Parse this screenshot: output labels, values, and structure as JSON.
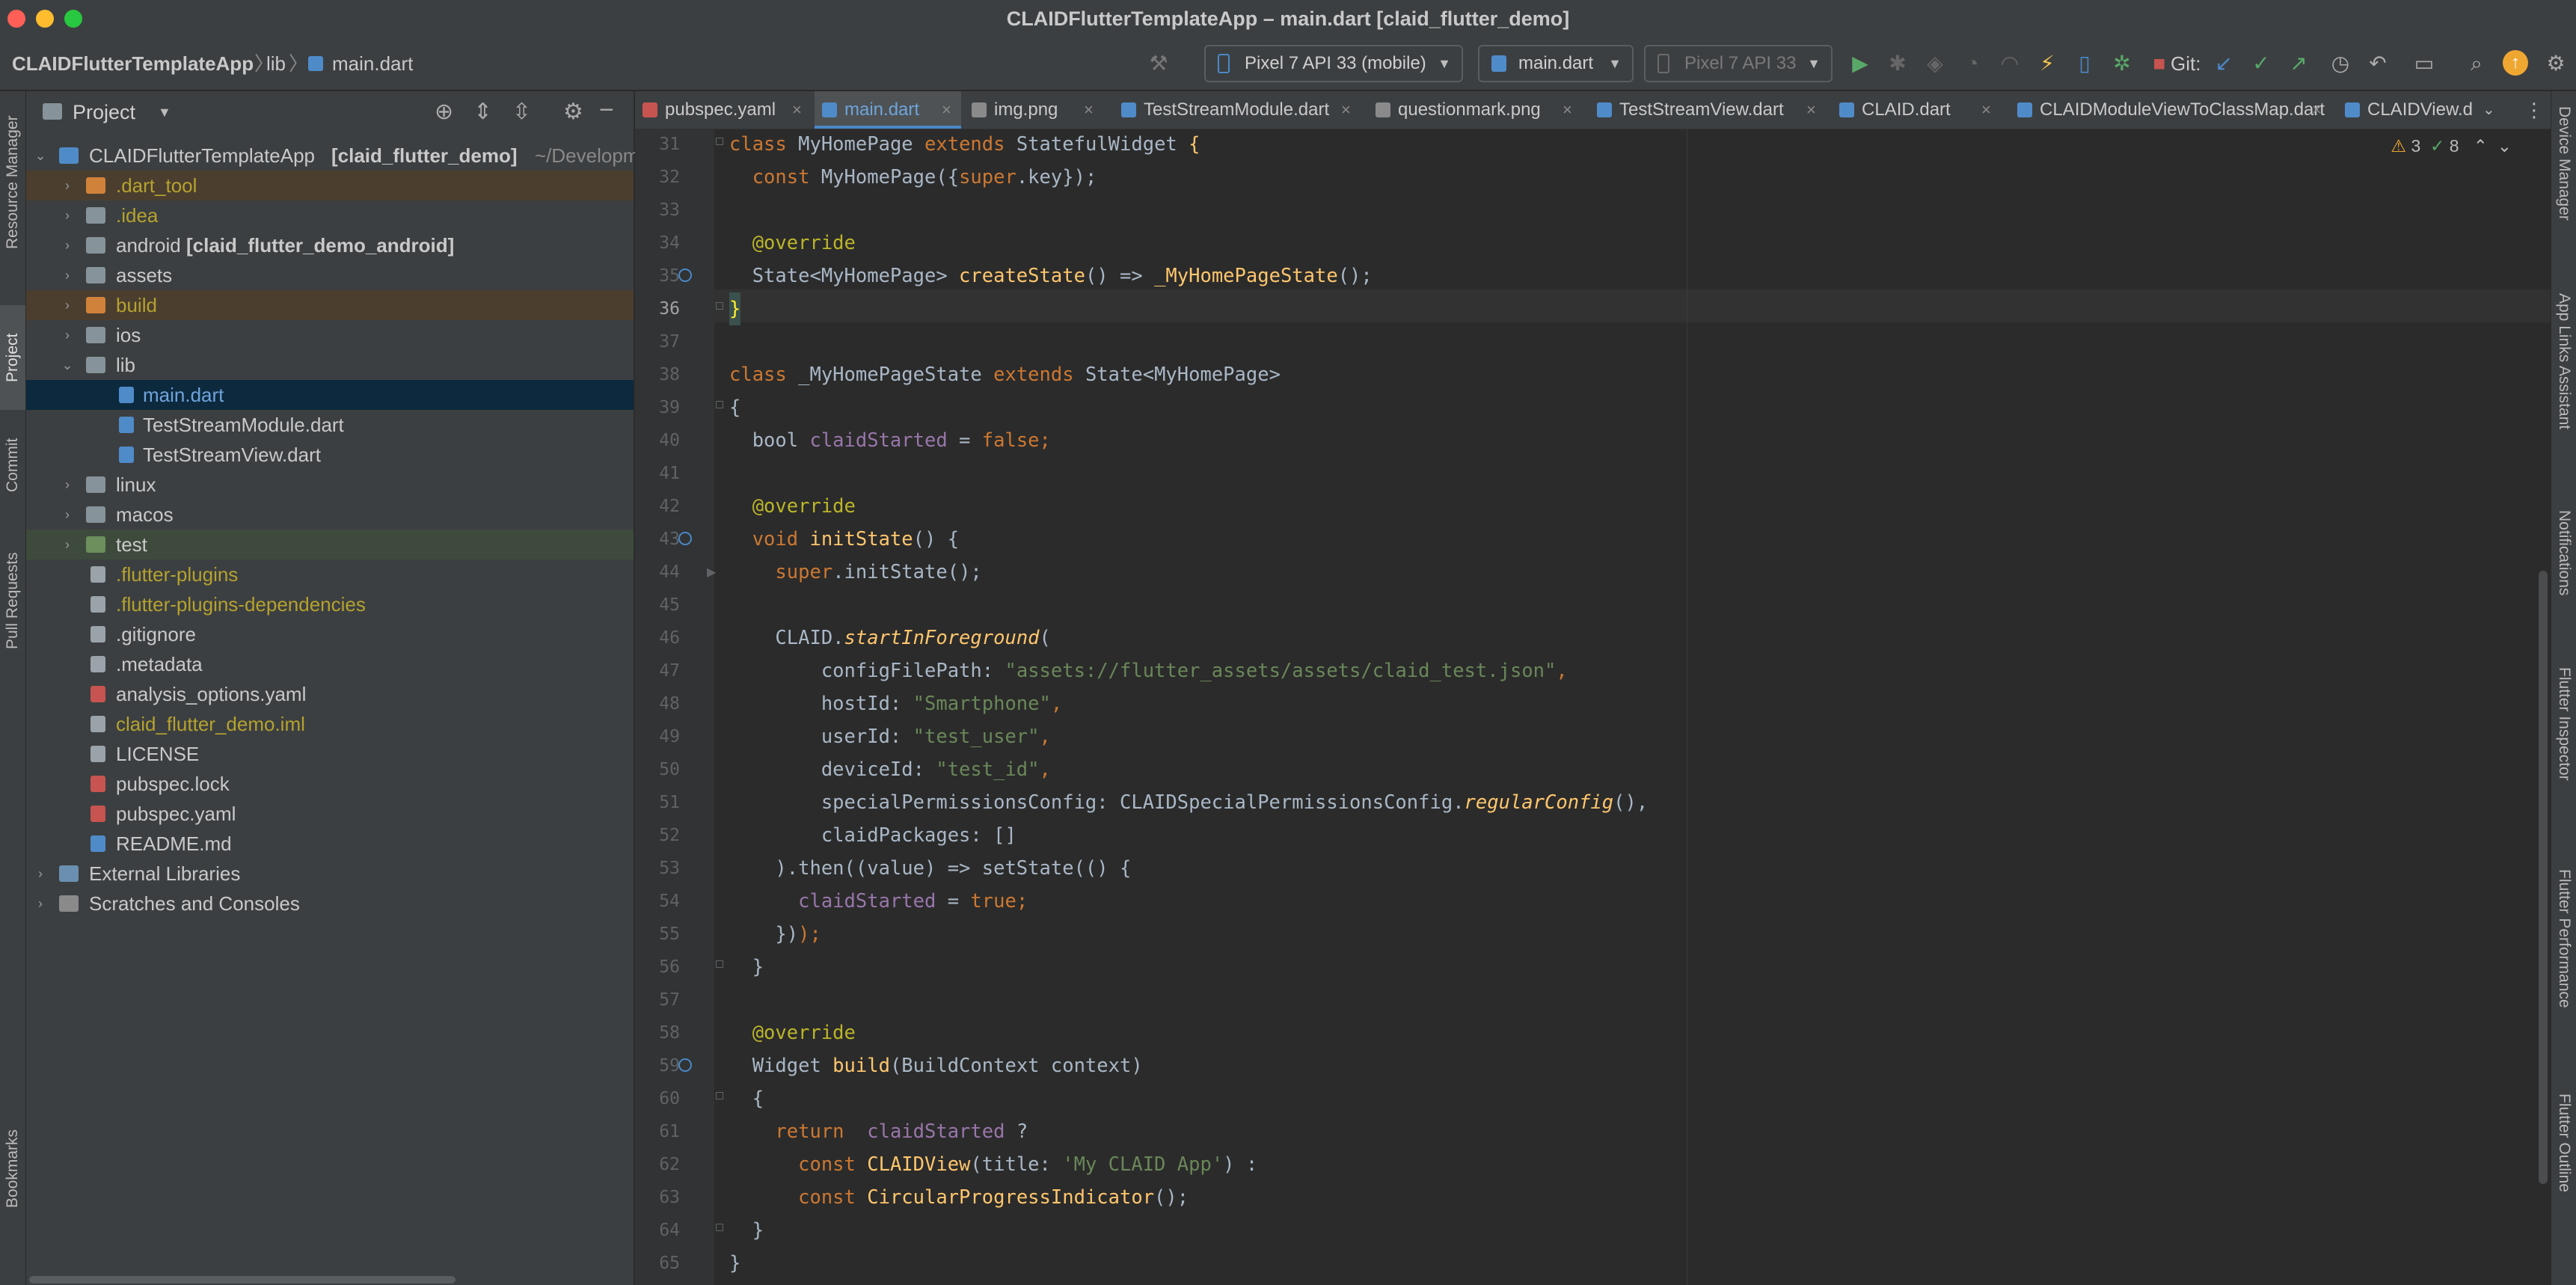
{
  "window": {
    "title": "CLAIDFlutterTemplateApp – main.dart [claid_flutter_demo]"
  },
  "toolbar": {
    "breadcrumb": [
      "CLAIDFlutterTemplateApp",
      "lib",
      "main.dart"
    ],
    "device_selector": "Pixel 7 API 33 (mobile)",
    "run_config": "main.dart",
    "emulator_selector": "Pixel 7 API 33",
    "git_label": "Git:"
  },
  "left_strip": [
    "Resource Manager",
    "Project",
    "Commit",
    "Pull Requests",
    "Bookmarks"
  ],
  "right_strip": [
    "Device Manager",
    "App Links Assistant",
    "Notifications",
    "Flutter Inspector",
    "Flutter Performance",
    "Flutter Outline"
  ],
  "project": {
    "header_label": "Project",
    "root_name": "CLAIDFlutterTemplateApp",
    "root_module": "[claid_flutter_demo]",
    "root_path": "~/Developm",
    "rows": [
      {
        "label": ".dart_tool"
      },
      {
        "label": ".idea"
      },
      {
        "label": "android"
      },
      {
        "label": "assets"
      },
      {
        "label": "build"
      },
      {
        "label": "ios"
      },
      {
        "label": "lib"
      },
      {
        "label": "main.dart"
      },
      {
        "label": "TestStreamModule.dart"
      },
      {
        "label": "TestStreamView.dart"
      },
      {
        "label": "linux"
      },
      {
        "label": "macos"
      },
      {
        "label": "test"
      },
      {
        "label": ".flutter-plugins"
      },
      {
        "label": ".flutter-plugins-dependencies"
      },
      {
        "label": ".gitignore"
      },
      {
        "label": ".metadata"
      },
      {
        "label": "analysis_options.yaml"
      },
      {
        "label": "claid_flutter_demo.iml"
      },
      {
        "label": "LICENSE"
      },
      {
        "label": "pubspec.lock"
      },
      {
        "label": "pubspec.yaml"
      },
      {
        "label": "README.md"
      },
      {
        "label": "External Libraries"
      },
      {
        "label": "Scratches and Consoles"
      }
    ],
    "android_module": "[claid_flutter_demo_android]"
  },
  "tabs": [
    "pubspec.yaml",
    "main.dart",
    "img.png",
    "TestStreamModule.dart",
    "questionmark.png",
    "TestStreamView.dart",
    "CLAID.dart",
    "CLAIDModuleViewToClassMap.dart",
    "CLAIDView.d"
  ],
  "inspections": {
    "warnings": "3",
    "ok": "8"
  },
  "editor": {
    "line_numbers": [
      "31",
      "32",
      "33",
      "34",
      "35",
      "36",
      "37",
      "38",
      "39",
      "40",
      "41",
      "42",
      "43",
      "44",
      "45",
      "46",
      "47",
      "48",
      "49",
      "50",
      "51",
      "52",
      "53",
      "54",
      "55",
      "56",
      "57",
      "58",
      "59",
      "60",
      "61",
      "62",
      "63",
      "64",
      "65"
    ]
  },
  "code": {
    "l31a": "class ",
    "l31b": "MyHomePage ",
    "l31c": "extends ",
    "l31d": "StatefulWidget ",
    "l31e": "{",
    "l32a": "  const ",
    "l32b": "MyHomePage({",
    "l32c": "super",
    "l32d": ".key});",
    "l34": "  @override",
    "l35a": "  State<MyHomePage> ",
    "l35b": "createState",
    "l35c": "() => ",
    "l35d": "_MyHomePageState",
    "l35e": "();",
    "l36": "}",
    "l38a": "class ",
    "l38b": "_MyHomePageState ",
    "l38c": "extends ",
    "l38d": "State<MyHomePage>",
    "l39": "{",
    "l40a": "  bool ",
    "l40b": "claidStarted",
    "l40c": " = ",
    "l40d": "false",
    "l40e": ";",
    "l42": "  @override",
    "l43a": "  void ",
    "l43b": "initState",
    "l43c": "() {",
    "l44a": "    ",
    "l44b": "super",
    "l44c": ".initState();",
    "l46a": "    CLAID.",
    "l46b": "startInForeground",
    "l46c": "(",
    "l47a": "        configFilePath: ",
    "l47b": "\"assets://flutter_assets/assets/claid_test.json\"",
    "l47c": ",",
    "l48a": "        hostId: ",
    "l48b": "\"Smartphone\"",
    "l48c": ",",
    "l49a": "        userId: ",
    "l49b": "\"test_user\"",
    "l49c": ",",
    "l50a": "        deviceId: ",
    "l50b": "\"test_id\"",
    "l50c": ",",
    "l51a": "        specialPermissionsConfig: CLAIDSpecialPermissionsConfig.",
    "l51b": "regularConfig",
    "l51c": "(),",
    "l52": "        claidPackages: []",
    "l53": "    ).then((value) => setState(() {",
    "l54a": "      ",
    "l54b": "claidStarted",
    "l54c": " = ",
    "l54d": "true",
    "l54e": ";",
    "l55a": "    })",
    "l55b": ");",
    "l56": "  }",
    "l58": "  @override",
    "l59a": "  Widget ",
    "l59b": "build",
    "l59c": "(BuildContext context)",
    "l60": "  {",
    "l61a": "    return  ",
    "l61b": "claidStarted",
    "l61c": " ?",
    "l62a": "      const ",
    "l62b": "CLAIDView",
    "l62c": "(title: ",
    "l62d": "'My CLAID App'",
    "l62e": ") :",
    "l63a": "      const ",
    "l63b": "CircularProgressIndicator",
    "l63c": "();",
    "l64": "  }",
    "l65": "}"
  },
  "colors": {
    "accent": "#4a88c7",
    "keyword": "#cc7832",
    "string": "#6a8759",
    "function": "#ffc66d"
  }
}
